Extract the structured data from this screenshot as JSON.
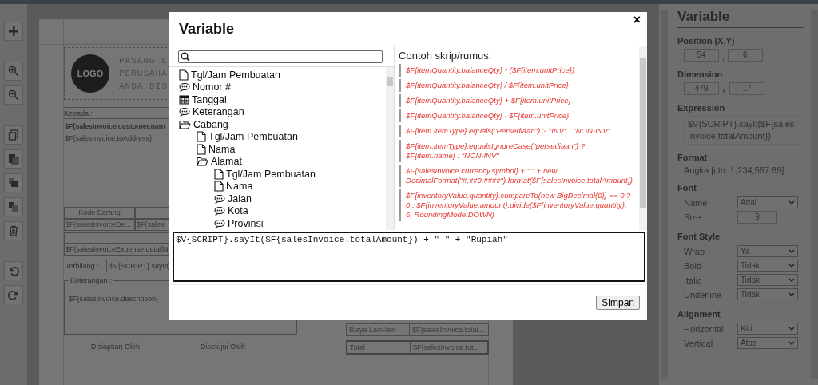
{
  "report": {
    "logo": {
      "label": "LOGO",
      "lines": [
        "PASANG L",
        "PERUSAHA",
        "ANDA DIS"
      ]
    },
    "to_label": "Kepada :",
    "customer_name": "$F{salesInvoice.customer.nam",
    "address": "$F{salesInvoice.toAddress}",
    "detail_table": {
      "header": [
        "Kode Barang"
      ],
      "row": [
        "$F{salesInvoiceDe...",
        "$F{salesI"
      ]
    },
    "expense_row": "$F{salesInvoiceExpense.detailN",
    "spelled_label": "Terbilang :",
    "spelled_value": "$V{SCRIPT}.sayIt(",
    "notes": {
      "legend": "Keterangan :",
      "value": "$F{salesInvoice.description}"
    },
    "signatures": [
      "Disiapkan Oleh",
      "Disetujui Oleh"
    ],
    "totals": [
      {
        "label": "Biaya Lain-lain",
        "value": "$F{salesInvoice.total...",
        "emphasized": false
      },
      {
        "label": "Total",
        "value": "$F{salesInvoice.tot...",
        "emphasized": true
      }
    ]
  },
  "properties": {
    "title": "Variable",
    "sections": [
      {
        "title": "Position (X,Y)",
        "kind": "pair",
        "values": [
          "54",
          "6"
        ],
        "separator": ","
      },
      {
        "title": "Dimension",
        "kind": "pair",
        "values": [
          "479",
          "17"
        ],
        "separator": "x"
      },
      {
        "title": "Expression",
        "kind": "box",
        "text": "$V{SCRIPT}.sayIt($F{salesInvoice.totalAmount})"
      },
      {
        "title": "Format",
        "kind": "text",
        "text": "Angka [cth: 1,234,567.89]"
      },
      {
        "title": "Font",
        "kind": "fields",
        "rows": [
          {
            "label": "Name",
            "kind": "select",
            "value": "Arial"
          },
          {
            "label": "Size",
            "kind": "input",
            "value": "9"
          }
        ]
      },
      {
        "title": "Font Style",
        "kind": "fields",
        "rows": [
          {
            "label": "Wrap",
            "kind": "select",
            "value": "Ya"
          },
          {
            "label": "Bold",
            "kind": "select",
            "value": "Tidak"
          },
          {
            "label": "Italic",
            "kind": "select",
            "value": "Tidak"
          },
          {
            "label": "Underline",
            "kind": "select",
            "value": "Tidak"
          }
        ]
      },
      {
        "title": "Alignment",
        "kind": "fields",
        "rows": [
          {
            "label": "Horizontal",
            "kind": "select",
            "value": "Kiri"
          },
          {
            "label": "Vertical",
            "kind": "select",
            "value": "Atas"
          }
        ]
      }
    ]
  },
  "dialog": {
    "title": "Variable",
    "close": "×",
    "tree": [
      {
        "label": "Tgl/Jam Pembuatan",
        "kind": "file"
      },
      {
        "label": "Nomor #",
        "kind": "comment"
      },
      {
        "label": "Tanggal",
        "kind": "calendar"
      },
      {
        "label": "Keterangan",
        "kind": "comment"
      },
      {
        "label": "Cabang",
        "kind": "folder",
        "expanded": true,
        "children": [
          {
            "label": "Tgl/Jam Pembuatan",
            "kind": "file"
          },
          {
            "label": "Nama",
            "kind": "file"
          },
          {
            "label": "Alamat",
            "kind": "folder",
            "expanded": true,
            "children": [
              {
                "label": "Tgl/Jam Pembuatan",
                "kind": "file"
              },
              {
                "label": "Nama",
                "kind": "file"
              },
              {
                "label": "Jalan",
                "kind": "comment"
              },
              {
                "label": "Kota",
                "kind": "comment"
              },
              {
                "label": "Provinsi",
                "kind": "comment"
              }
            ]
          }
        ]
      }
    ],
    "examples_title": "Contoh skrip/rumus:",
    "examples": [
      "$F{itemQuantity.balanceQty} * ($F{item.unitPrice})",
      "$F{itemQuantity.balanceQty} / $F{item.unitPrice}",
      "$F{itemQuantity.balanceQty} + $F{item.unitPrice}",
      "$F{itemQuantity.balanceQty} - $F{item.unitPrice}",
      "$F{item.itemType}.equals(\"Persediaan\") ? \"INV\" : \"NON-INV\"",
      "$F{item.itemType}.equalsIgnoreCase(\"persediaan\") ? $F{item.name} : \"NON-INV\"",
      "$F{salesInvoice.currency.symbol} + \" \" + new DecimalFormat(\"#,##0.####\").format($F{salesInvoice.totalAmount})",
      "$F{inventoryValue.quantity}.compareTo(new BigDecimal(0)) == 0 ? 0 : $F{inventoryValue.amount}.divide($F{inventoryValue.quantity}, 6, RoundingMode.DOWN)"
    ],
    "editor": "$V{SCRIPT}.sayIt($F{salesInvoice.totalAmount}) + \" \" + \"Rupiah\"",
    "save_button": "Simpan"
  }
}
